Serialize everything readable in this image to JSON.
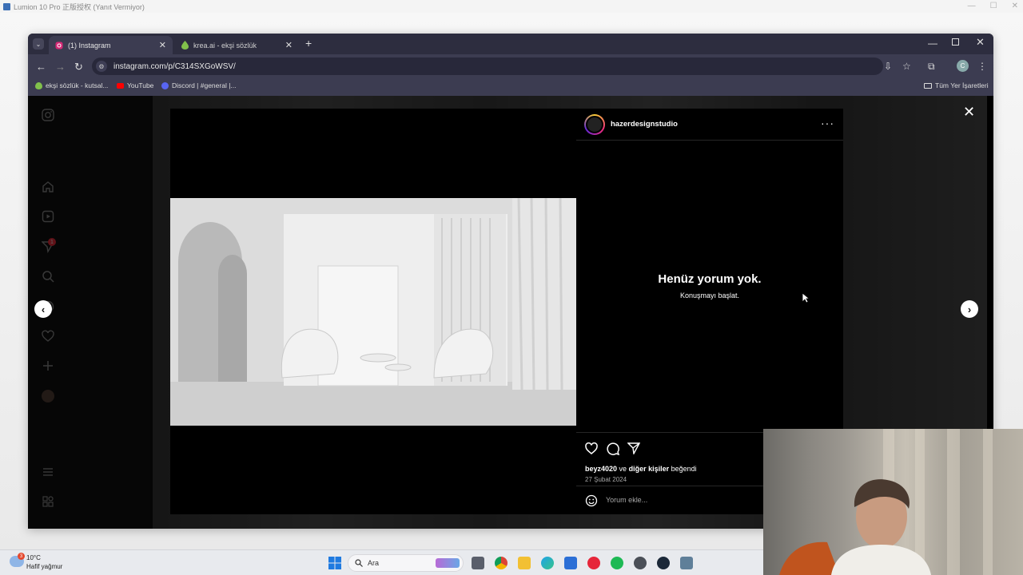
{
  "app_window": {
    "title": "Lumion 10 Pro 正版授权 (Yanıt Vermiyor)"
  },
  "browser": {
    "tabs": [
      {
        "label": "(1) Instagram",
        "active": true
      },
      {
        "label": "krea.ai - ekşi sözlük",
        "active": false
      }
    ],
    "url": "instagram.com/p/C314SXGoWSV/",
    "bookmarks": [
      {
        "label": "ekşi sözlük - kutsal..."
      },
      {
        "label": "YouTube"
      },
      {
        "label": "Discord | #general |..."
      }
    ],
    "all_bookmarks_label": "Tüm Yer İşaretleri",
    "profile_initial": "C"
  },
  "instagram": {
    "notification_count": "1",
    "post": {
      "author": "hazerdesignstudio",
      "empty_title": "Henüz yorum yok.",
      "empty_subtitle": "Konuşmayı başlat.",
      "liked_by_user": "beyz4020",
      "liked_by_connector": "ve",
      "liked_by_others": "diğer kişiler",
      "liked_suffix": "beğendi",
      "date": "27 Şubat 2024",
      "comment_placeholder": "Yorum ekle..."
    }
  },
  "taskbar": {
    "weather_badge": "3",
    "temperature": "10°C",
    "weather_desc": "Hafif yağmur",
    "search_label": "Ara"
  },
  "colors": {
    "ig_bg": "#000000",
    "tab_strip": "#2d2d3f",
    "toolbar": "#3c3c51",
    "notification_red": "#ff3040"
  }
}
